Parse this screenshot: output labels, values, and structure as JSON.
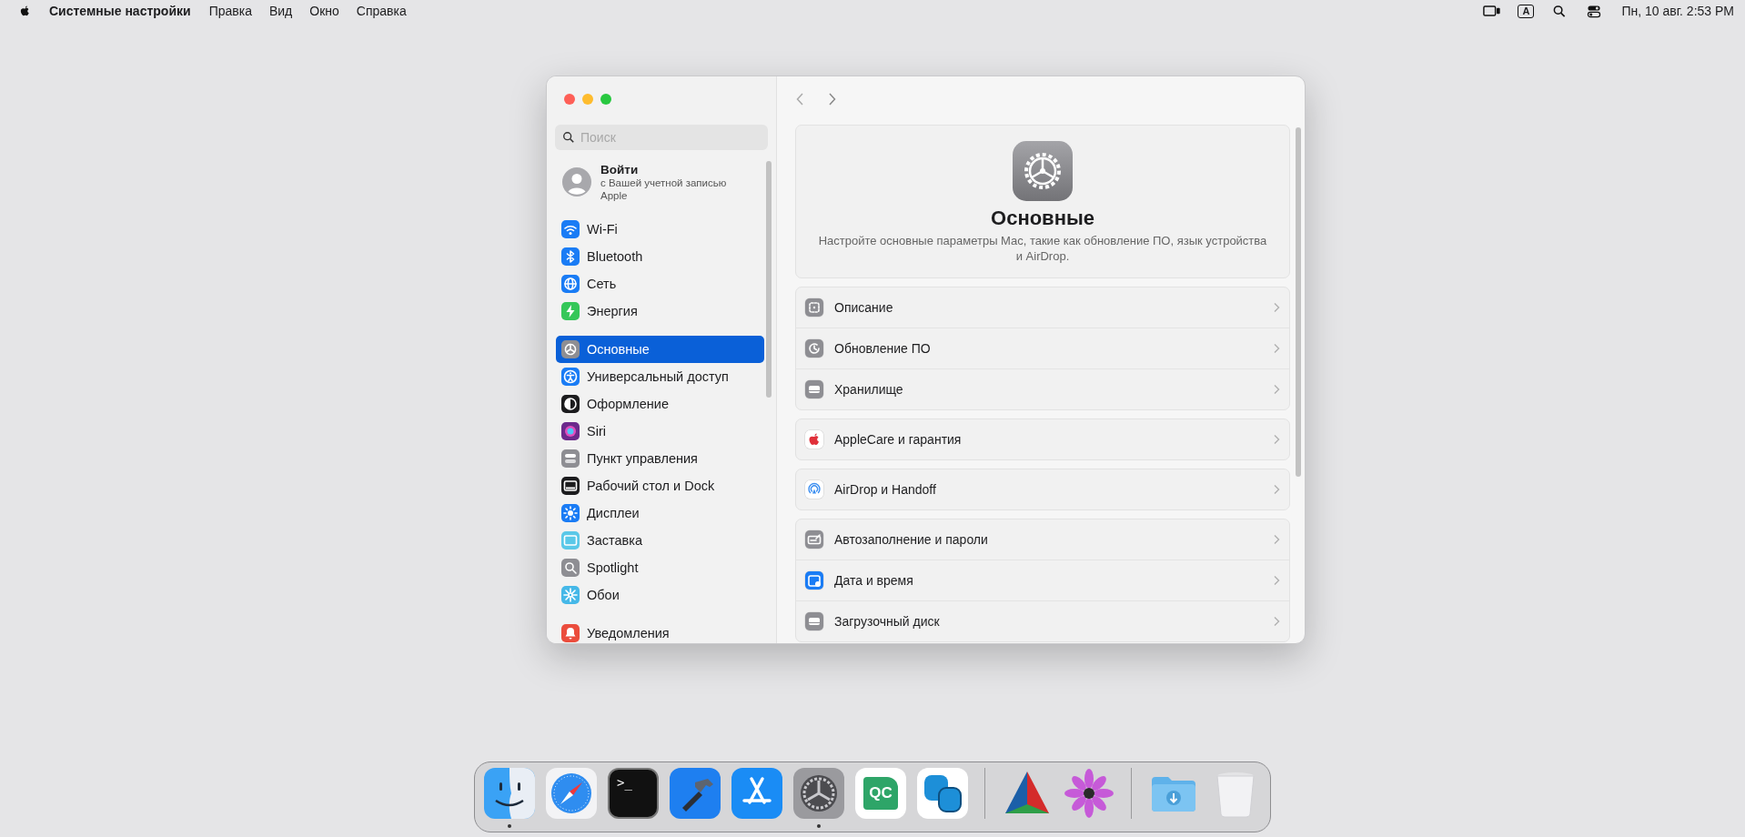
{
  "menu_bar": {
    "app_name": "Системные настройки",
    "menus": [
      "Правка",
      "Вид",
      "Окно",
      "Справка"
    ],
    "input_source": "A",
    "clock": "Пн, 10 авг.  2:53 PM"
  },
  "window": {
    "search": {
      "placeholder": "Поиск"
    },
    "account": {
      "title": "Войти",
      "subtitle": "с Вашей учетной записью Apple"
    },
    "sidebar": {
      "groups": [
        {
          "items": [
            {
              "label": "Wi-Fi",
              "kind": "wifi",
              "color": "#1a7cf5",
              "selected": false
            },
            {
              "label": "Bluetooth",
              "kind": "bluetooth",
              "color": "#1a7cf5",
              "selected": false
            },
            {
              "label": "Сеть",
              "kind": "globe",
              "color": "#1a7cf5",
              "selected": false
            },
            {
              "label": "Энергия",
              "kind": "bolt",
              "color": "#35c759",
              "selected": false
            }
          ]
        },
        {
          "items": [
            {
              "label": "Основные",
              "kind": "gear",
              "color": "#8e8e93",
              "selected": true
            },
            {
              "label": "Универсальный доступ",
              "kind": "accessibility",
              "color": "#1a7cf5",
              "selected": false
            },
            {
              "label": "Оформление",
              "kind": "appearance",
              "color": "#1c1c1e",
              "selected": false
            },
            {
              "label": "Siri",
              "kind": "siri",
              "color": "#6b2a8c",
              "selected": false
            },
            {
              "label": "Пункт управления",
              "kind": "toggles",
              "color": "#8e8e93",
              "selected": false
            },
            {
              "label": "Рабочий стол и Dock",
              "kind": "dock",
              "color": "#1c1c1e",
              "selected": false
            },
            {
              "label": "Дисплеи",
              "kind": "sun",
              "color": "#1a7cf5",
              "selected": false
            },
            {
              "label": "Заставка",
              "kind": "screen",
              "color": "#5ac8e8",
              "selected": false
            },
            {
              "label": "Spotlight",
              "kind": "search",
              "color": "#8e8e93",
              "selected": false
            },
            {
              "label": "Обои",
              "kind": "flower",
              "color": "#45b8e8",
              "selected": false
            }
          ]
        },
        {
          "items": [
            {
              "label": "Уведомления",
              "kind": "bell",
              "color": "#eb4d3d",
              "selected": false
            }
          ]
        }
      ]
    },
    "header": {
      "title": "Основные",
      "description": "Настройте основные параметры Mac, такие как обновление ПО, язык устройства и AirDrop."
    },
    "groups": [
      {
        "rows": [
          {
            "label": "Описание",
            "kind": "info",
            "color": "#8e8e93"
          },
          {
            "label": "Обновление ПО",
            "kind": "update",
            "color": "#8e8e93"
          },
          {
            "label": "Хранилище",
            "kind": "storage",
            "color": "#8e8e93"
          }
        ]
      },
      {
        "rows": [
          {
            "label": "AppleCare и гарантия",
            "kind": "apple",
            "color": "#ffffff"
          }
        ]
      },
      {
        "rows": [
          {
            "label": "AirDrop и Handoff",
            "kind": "airdrop",
            "color": "#ffffff"
          }
        ]
      },
      {
        "rows": [
          {
            "label": "Автозаполнение и пароли",
            "kind": "autofill",
            "color": "#8e8e93"
          },
          {
            "label": "Дата и время",
            "kind": "calendar",
            "color": "#1a7cf5"
          },
          {
            "label": "Загрузочный диск",
            "kind": "storage",
            "color": "#8e8e93"
          }
        ]
      }
    ]
  },
  "dock": {
    "groups": [
      {
        "items": [
          {
            "kind": "finder",
            "running": true
          },
          {
            "kind": "safari",
            "running": false
          },
          {
            "kind": "terminal",
            "label": ">_",
            "running": false
          },
          {
            "kind": "xcode",
            "running": false
          },
          {
            "kind": "appstore",
            "running": false
          },
          {
            "kind": "settings",
            "running": true
          },
          {
            "kind": "qc",
            "label": "QC",
            "running": false
          },
          {
            "kind": "hands",
            "running": false
          }
        ]
      },
      {
        "items": [
          {
            "kind": "triangle",
            "running": false
          },
          {
            "kind": "flower",
            "running": false
          }
        ]
      },
      {
        "items": [
          {
            "kind": "downloads",
            "running": false
          },
          {
            "kind": "trash",
            "running": false
          }
        ]
      }
    ]
  }
}
